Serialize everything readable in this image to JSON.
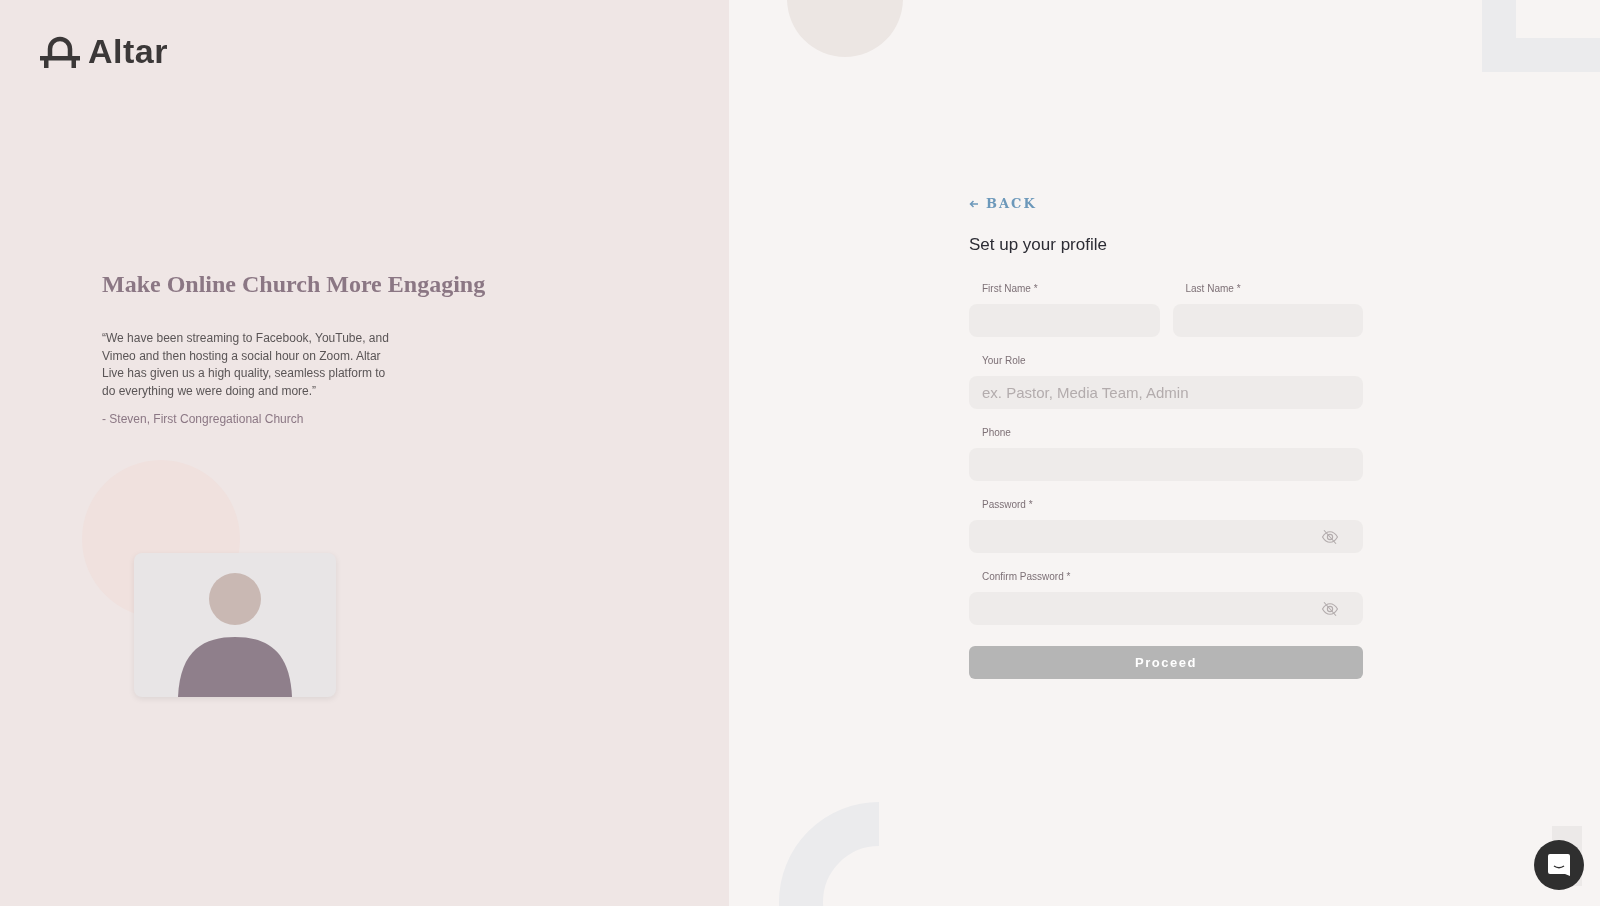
{
  "brand": {
    "name": "Altar"
  },
  "promo": {
    "headline": "Make Online Church More Engaging",
    "quote": "“We have been streaming to Facebook, YouTube, and Vimeo and then hosting a social hour on Zoom. Altar Live has given us a high quality, seamless platform to do everything we were doing and more.”",
    "attribution": "- Steven, First Congregational Church"
  },
  "back_link": {
    "label": "BACK"
  },
  "form": {
    "title": "Set up your profile",
    "rows": [
      [
        {
          "label": "First Name *",
          "kind": "text"
        },
        {
          "label": "Last Name *",
          "kind": "text"
        }
      ],
      [
        {
          "label": "Your Role",
          "kind": "text",
          "placeholder": "ex. Pastor, Media Team, Admin"
        }
      ],
      [
        {
          "label": "Phone",
          "kind": "text"
        }
      ],
      [
        {
          "label": "Password *",
          "kind": "password"
        }
      ],
      [
        {
          "label": "Confirm Password *",
          "kind": "password"
        }
      ]
    ],
    "submit": {
      "label": "Proceed",
      "disabled": true
    }
  }
}
